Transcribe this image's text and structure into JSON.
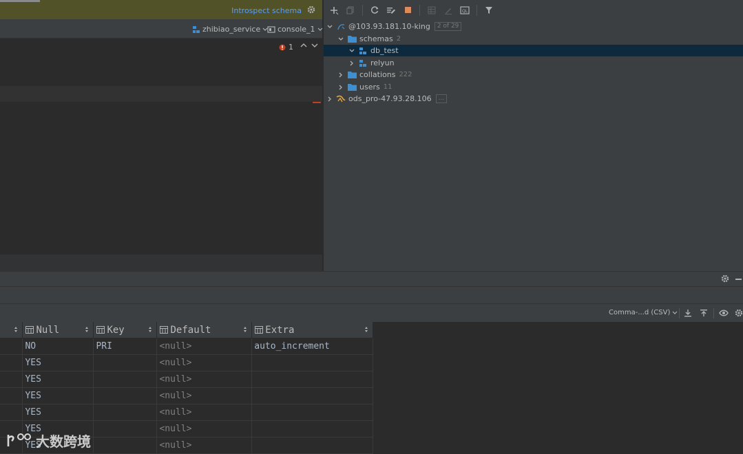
{
  "editor": {
    "introspect_link": "Introspect schema",
    "datasource": "zhibiao_service",
    "console": "console_1",
    "error_count": "1"
  },
  "db_tree": {
    "rows": [
      {
        "label": "@103.93.181.10-king",
        "count": "",
        "badge": "2 of 29"
      },
      {
        "label": "schemas",
        "count": "2",
        "badge": ""
      },
      {
        "label": "db_test",
        "count": "",
        "badge": ""
      },
      {
        "label": "relyun",
        "count": "",
        "badge": ""
      },
      {
        "label": "collations",
        "count": "222",
        "badge": ""
      },
      {
        "label": "users",
        "count": "11",
        "badge": ""
      },
      {
        "label": "ods_pro-47.93.28.106",
        "count": "",
        "badge": "..."
      }
    ]
  },
  "results": {
    "export_format": "Comma-...d (CSV)",
    "columns": [
      "Null",
      "Key",
      "Default",
      "Extra"
    ],
    "rows": [
      [
        "NO",
        "PRI",
        "<null>",
        "auto_increment"
      ],
      [
        "YES",
        "",
        "<null>",
        ""
      ],
      [
        "YES",
        "",
        "<null>",
        ""
      ],
      [
        "YES",
        "",
        "<null>",
        ""
      ],
      [
        "YES",
        "",
        "<null>",
        ""
      ],
      [
        "YES",
        "",
        "<null>",
        ""
      ],
      [
        "YES",
        "",
        "<null>",
        ""
      ]
    ]
  },
  "watermark": {
    "text": "大数跨境"
  },
  "colors": {
    "accent": "#589df6",
    "selection": "#0d293e",
    "folder": "#3d8fd1",
    "introspect_bar": "#525228",
    "error": "#c24020"
  }
}
